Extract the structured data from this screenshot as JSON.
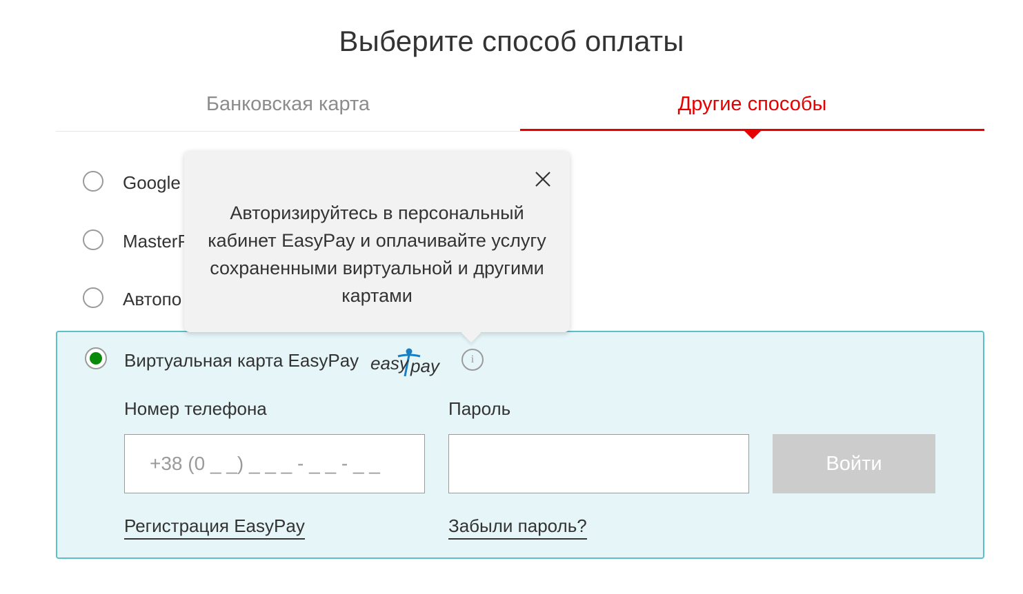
{
  "page_title": "Выберите способ оплаты",
  "tabs": [
    {
      "label": "Банковская карта",
      "active": false
    },
    {
      "label": "Другие способы",
      "active": true
    }
  ],
  "accent_color": "#e60000",
  "options": [
    {
      "label": "Google",
      "selected": false
    },
    {
      "label": "MasterP",
      "selected": false
    },
    {
      "label": "Автопо",
      "selected": false
    }
  ],
  "easypay": {
    "label": "Виртуальная карта EasyPay",
    "selected": true,
    "logo_text": "easypay",
    "info_icon": "info-icon",
    "phone": {
      "label": "Номер телефона",
      "placeholder": "+38 (0 _ _) _ _ _ - _ _ - _ _",
      "value": ""
    },
    "password": {
      "label": "Пароль",
      "value": ""
    },
    "login_button": "Войти",
    "register_link": "Регистрация EasyPay",
    "forgot_link": "Забыли пароль?"
  },
  "tooltip": {
    "text": "Авторизируйтесь в персональный кабинет EasyPay и оплачивайте услугу сохраненными виртуальной и другими картами",
    "close_icon": "close-icon"
  }
}
